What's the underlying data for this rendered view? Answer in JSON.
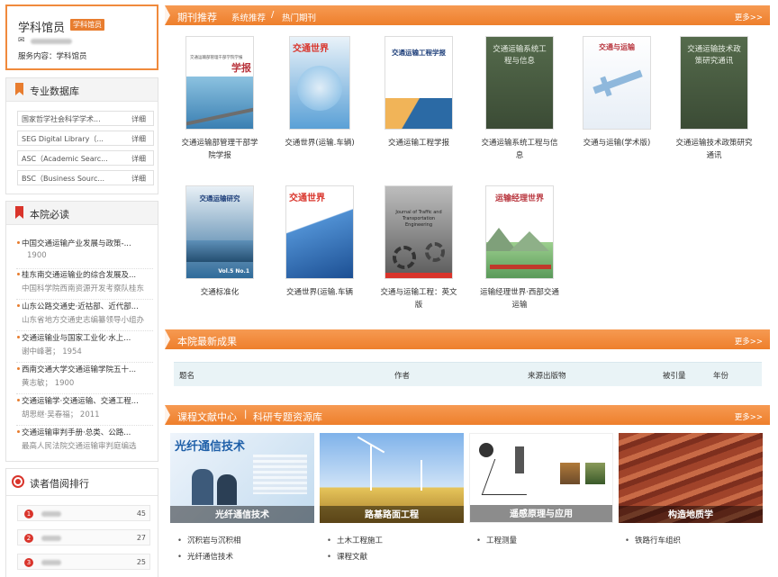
{
  "librarian": {
    "name": "学科馆员",
    "badge": "学科馆员",
    "email_icon": "✉",
    "service": "服务内容：学科馆员"
  },
  "databases": {
    "title": "专业数据库",
    "items": [
      {
        "label": "国家哲学社会科学学术...",
        "detail": "详细"
      },
      {
        "label": "SEG Digital Library（...",
        "detail": "详细"
      },
      {
        "label": "ASC（Academic Searc...",
        "detail": "详细"
      },
      {
        "label": "BSC（Business Sourc...",
        "detail": "详细"
      }
    ]
  },
  "must_read": {
    "title": "本院必读",
    "items": [
      {
        "title": "中国交通运输产业发展与政策-...",
        "sub": "1900"
      },
      {
        "title": "桂东南交通运输业的综合发展及...",
        "sub": "中国科学院西南资源开发考察队桂东"
      },
      {
        "title": "山东公路交通史·近祜部、近代部...",
        "sub": "山东省地方交通史志编纂领导小组办"
      },
      {
        "title": "交通运输业与国家工业化·水上...",
        "sub": "谢中峰著；  1954"
      },
      {
        "title": "西南交通大学交通运输学院五十...",
        "sub": "黄志敏；  1900"
      },
      {
        "title": "交通运输学·交通运输、交通工程...",
        "sub": "胡思继·吴春福；  2011"
      },
      {
        "title": "交通运输审判手册·总类、公路...",
        "sub": "最高人民法院交通运输审判庭编选"
      }
    ]
  },
  "ranking": {
    "title": "读者借阅排行",
    "items": [
      {
        "num": "1",
        "count": "45"
      },
      {
        "num": "2",
        "count": "27"
      },
      {
        "num": "3",
        "count": "25"
      }
    ]
  },
  "journals": {
    "title": "期刊推荐",
    "tabs": [
      "系统推荐",
      "热门期刊"
    ],
    "tab_sep": "/",
    "more": "更多>>",
    "items": [
      {
        "name": "交通运输部管理干部学院学报",
        "cover_title": "交通运输部管理干部学院学报"
      },
      {
        "name": "交通世界(运输.车辆)",
        "cover_title": "交通世界"
      },
      {
        "name": "交通运输工程学报",
        "cover_title": "交通运输工程学报"
      },
      {
        "name": "交通运输系统工程与信息",
        "cover_title": "交通运输系统工程与信息"
      },
      {
        "name": "交通与运输(学术版)",
        "cover_title": "交通与运输"
      },
      {
        "name": "交通运输技术政策研究通讯",
        "cover_title": "交通运输技术政策研究通讯"
      },
      {
        "name": "交通标准化",
        "cover_title": "交通运输研究"
      },
      {
        "name": "交通世界(运输.车辆",
        "cover_title": "交通世界"
      },
      {
        "name": "交通与运输工程：英文版",
        "cover_title": "Journal of Traffic and Transportation Engineering"
      },
      {
        "name": "运输经理世界·西部交通运输",
        "cover_title": "运输经理世界"
      }
    ]
  },
  "achievements": {
    "title": "本院最新成果",
    "more": "更多>>",
    "columns": [
      "题名",
      "作者",
      "来源出版物",
      "被引量",
      "年份"
    ]
  },
  "courses": {
    "title": "课程文献中心",
    "sep": "|",
    "title2": "科研专题资源库",
    "more": "更多>>",
    "items": [
      {
        "label": "光纤通信技术",
        "banner": "光纤通信技术",
        "links": [
          "沉积岩与沉积相",
          "光纤通信技术"
        ]
      },
      {
        "label": "路基路面工程",
        "links": [
          "土木工程施工",
          "课程文献"
        ]
      },
      {
        "label": "遥感原理与应用",
        "links": [
          "工程测量"
        ]
      },
      {
        "label": "构造地质学",
        "links": [
          "铁路行车组织"
        ]
      }
    ]
  },
  "colors": {
    "accent": "#ee7f2c",
    "badge": "#e87d2f",
    "rank": "#d9342b"
  }
}
